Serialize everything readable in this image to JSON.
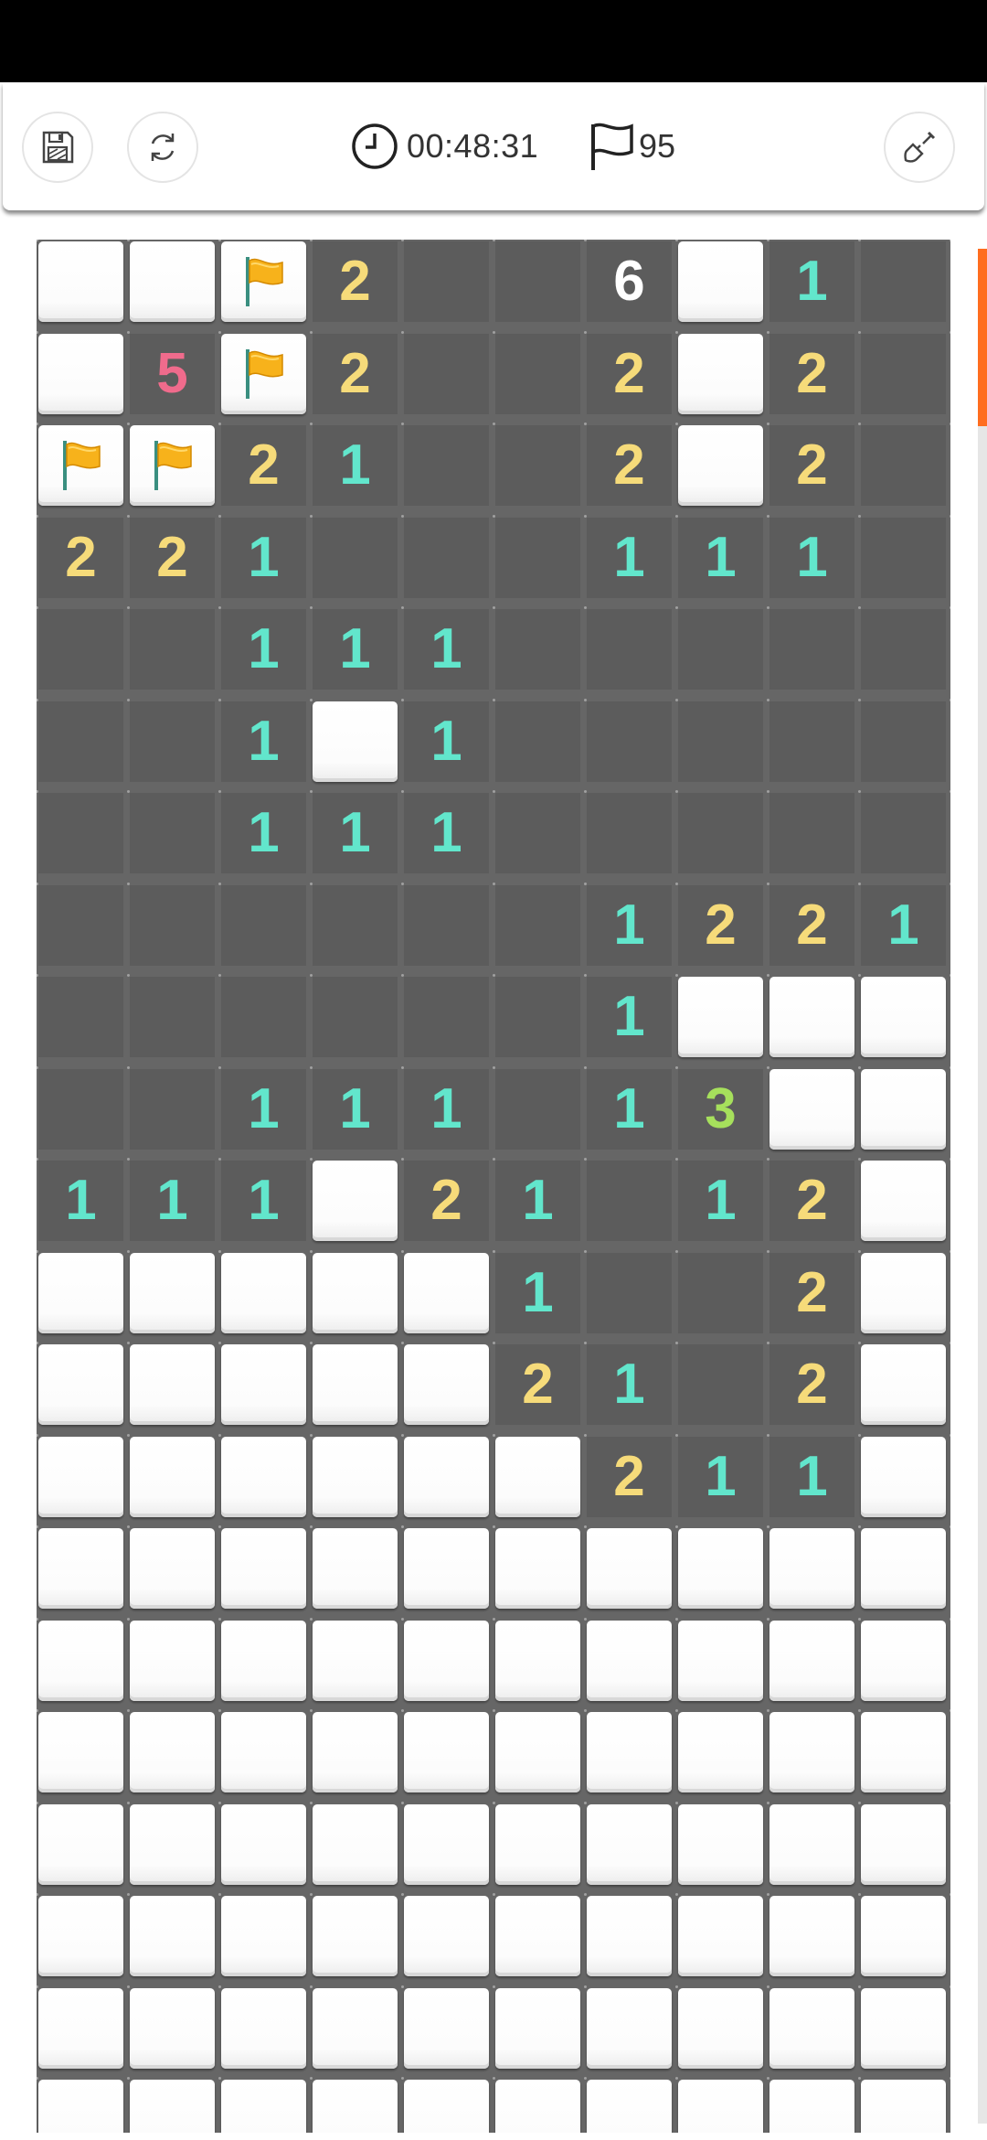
{
  "header": {
    "timer": "00:48:31",
    "flag_count": "95"
  },
  "icons": {
    "save": "save-icon",
    "restart": "restart-icon",
    "timer": "clock-icon",
    "flags": "flag-icon",
    "tool": "shovel-icon",
    "flagged_cell": "flag-icon"
  },
  "colors": {
    "one": "#62e6cc",
    "two": "#f6db7a",
    "three": "#a6e05c",
    "five": "#f06b8c",
    "accent": "#ff6d1f",
    "open_cell": "#5c5c5c",
    "grid": "#666666"
  },
  "board": {
    "columns": 10,
    "legend": "C = closed, F = flagged, 0 = opened empty, digit = adjacent mine count",
    "rows": [
      "CCF2006C10",
      "C5F2002C20",
      "FF21002C20",
      "2210001110",
      "0011100000",
      "001C100000",
      "0011100000",
      "0000001221",
      "000000 1CCC",
      "0011101 3CC",
      "111C21012C",
      "CCCCC1002C",
      "CCCCC2102C",
      "CCCCCC211C",
      "CCCCCCCCCC",
      "CCCCCCCCCC",
      "CCCCCCCCCC",
      "CCCCCCCCCC",
      "CCCCCCCCCC",
      "CCCCCCCCCC",
      "CCCCCCCCCC"
    ]
  }
}
